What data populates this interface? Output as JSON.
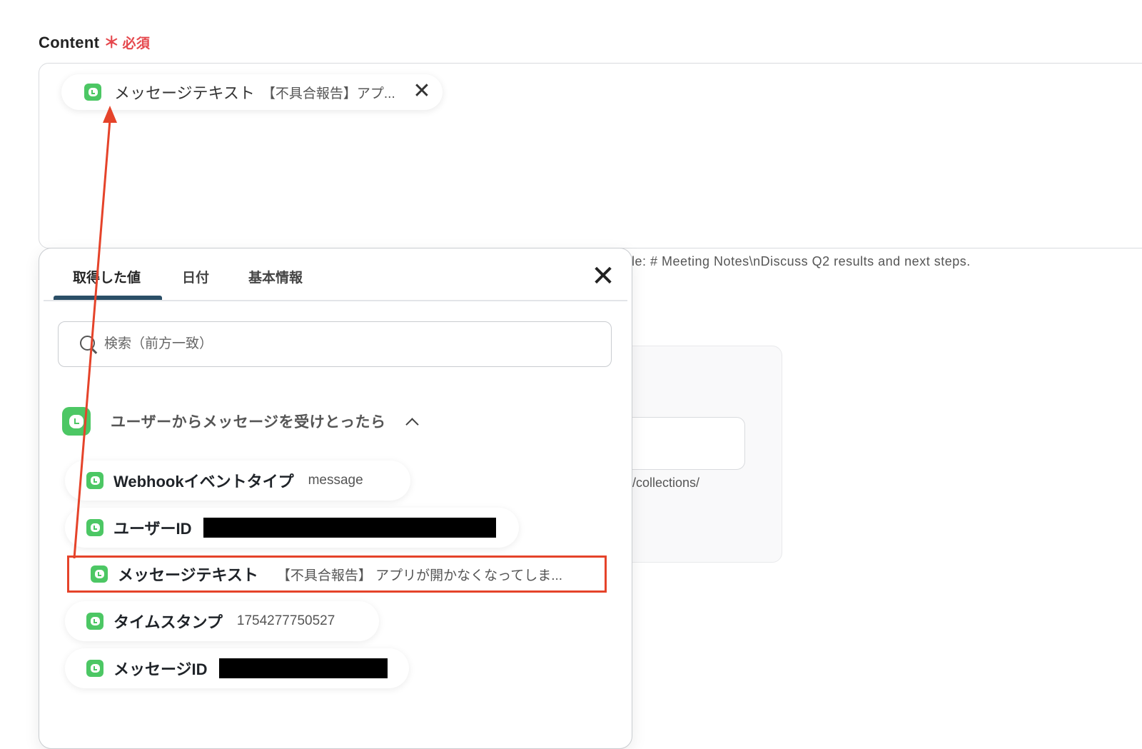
{
  "field": {
    "label": "Content",
    "required_star": "＊",
    "required_text": "必須"
  },
  "token": {
    "label": "メッセージテキスト",
    "value": "【不具合報告】アプ...",
    "close": "✕"
  },
  "hint": {
    "example": "le: # Meeting Notes\\nDiscuss Q2 results and next steps.",
    "url_fragment": "i/collections/"
  },
  "popup": {
    "tabs": [
      {
        "label": "取得した値",
        "active": true
      },
      {
        "label": "日付",
        "active": false
      },
      {
        "label": "基本情報",
        "active": false
      }
    ],
    "close": "✕",
    "search": {
      "placeholder": "検索（前方一致）"
    },
    "group": {
      "title": "ユーザーからメッセージを受けとったら",
      "icon": "line-icon",
      "expanded": true
    },
    "items": [
      {
        "label": "Webhookイベントタイプ",
        "value": "message"
      },
      {
        "label": "ユーザーID",
        "value": "",
        "redacted": true
      },
      {
        "label": "メッセージテキスト",
        "value": "【不具合報告】 アプリが開かなくなってしま...",
        "highlighted": true
      },
      {
        "label": "タイムスタンプ",
        "value": "1754277750527"
      },
      {
        "label": "メッセージID",
        "value": "",
        "redacted": true
      }
    ]
  },
  "colors": {
    "accent_red": "#e5432a",
    "line_green": "#4cc764",
    "tab_underline": "#2b4f67"
  }
}
